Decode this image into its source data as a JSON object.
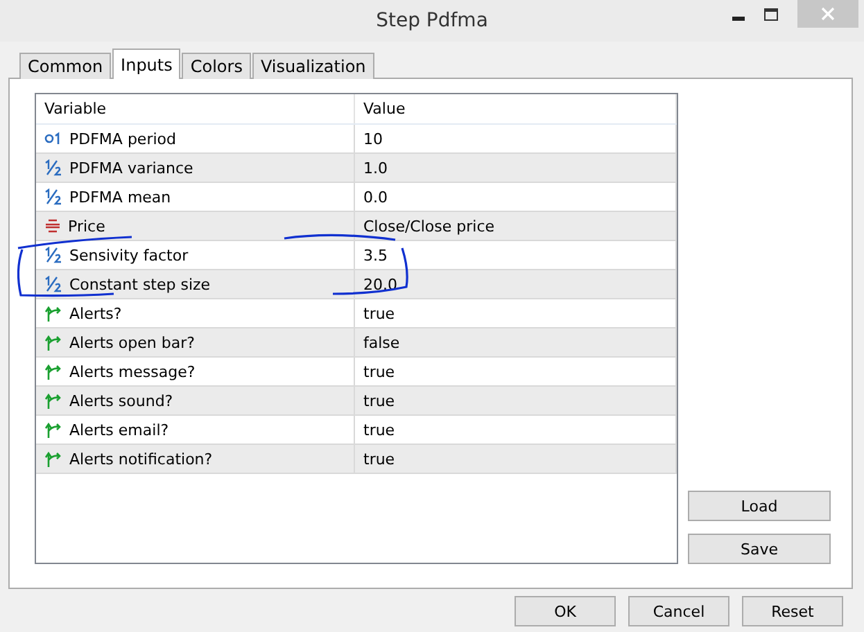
{
  "window": {
    "title": "Step Pdfma"
  },
  "tabs": [
    {
      "label": "Common",
      "selected": false
    },
    {
      "label": "Inputs",
      "selected": true
    },
    {
      "label": "Colors",
      "selected": false
    },
    {
      "label": "Visualization",
      "selected": false
    }
  ],
  "table": {
    "columns": [
      "Variable",
      "Value"
    ],
    "rows": [
      {
        "kind": "int",
        "variable": "PDFMA period",
        "value": "10"
      },
      {
        "kind": "double",
        "variable": "PDFMA variance",
        "value": "1.0"
      },
      {
        "kind": "double",
        "variable": "PDFMA mean",
        "value": "0.0"
      },
      {
        "kind": "enum",
        "variable": "Price",
        "value": "Close/Close price"
      },
      {
        "kind": "double",
        "variable": "Sensivity factor",
        "value": "3.5"
      },
      {
        "kind": "double",
        "variable": "Constant step size",
        "value": "20.0"
      },
      {
        "kind": "bool",
        "variable": "Alerts?",
        "value": "true"
      },
      {
        "kind": "bool",
        "variable": "Alerts open bar?",
        "value": "false"
      },
      {
        "kind": "bool",
        "variable": "Alerts message?",
        "value": "true"
      },
      {
        "kind": "bool",
        "variable": "Alerts sound?",
        "value": "true"
      },
      {
        "kind": "bool",
        "variable": "Alerts email?",
        "value": "true"
      },
      {
        "kind": "bool",
        "variable": "Alerts notification?",
        "value": "true"
      }
    ]
  },
  "side_buttons": [
    "Load",
    "Save"
  ],
  "buttons": [
    "OK",
    "Cancel",
    "Reset"
  ]
}
